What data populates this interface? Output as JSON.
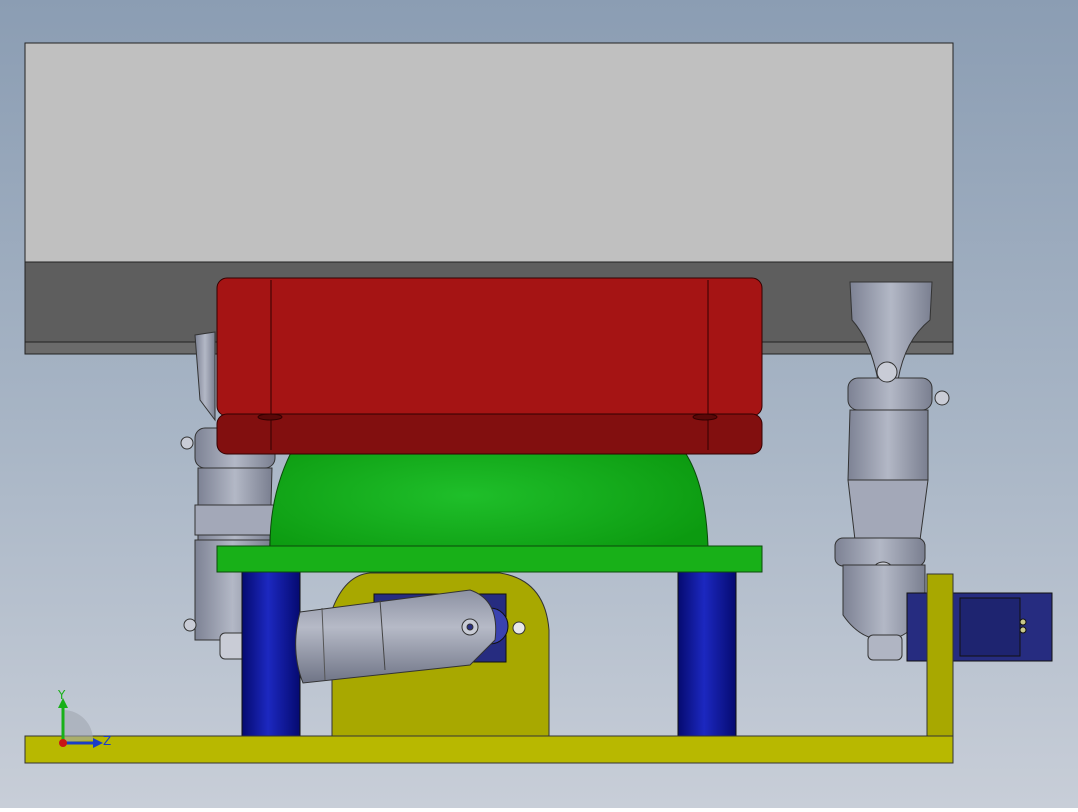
{
  "view": {
    "background_top": "#8b9db3",
    "background_bottom": "#c8ced8"
  },
  "model": {
    "parts": [
      {
        "name": "upper-platform-block",
        "color": "#c0c0c0"
      },
      {
        "name": "upper-platform-underside",
        "color": "#5a5a5a"
      },
      {
        "name": "red-mounting-plate",
        "color": "#a51414"
      },
      {
        "name": "green-dome-cover",
        "color": "#14a514"
      },
      {
        "name": "green-base-plate",
        "color": "#18b018"
      },
      {
        "name": "blue-support-columns",
        "color": "#0a12a0"
      },
      {
        "name": "yellow-servo-bracket",
        "color": "#a8a800"
      },
      {
        "name": "yellow-base-plate",
        "color": "#b8b800"
      },
      {
        "name": "servo-motor",
        "color": "#262c80"
      },
      {
        "name": "servo-horn-arm",
        "color": "#9aa0b2"
      },
      {
        "name": "universal-joint-left",
        "color": "#9aa0b2"
      },
      {
        "name": "universal-joint-right",
        "color": "#9aa0b2"
      }
    ]
  },
  "triad": {
    "y_label": "Y",
    "z_label": "Z",
    "y_color": "#18b018",
    "z_color": "#1a3cc8",
    "x_color": "#c81414"
  }
}
